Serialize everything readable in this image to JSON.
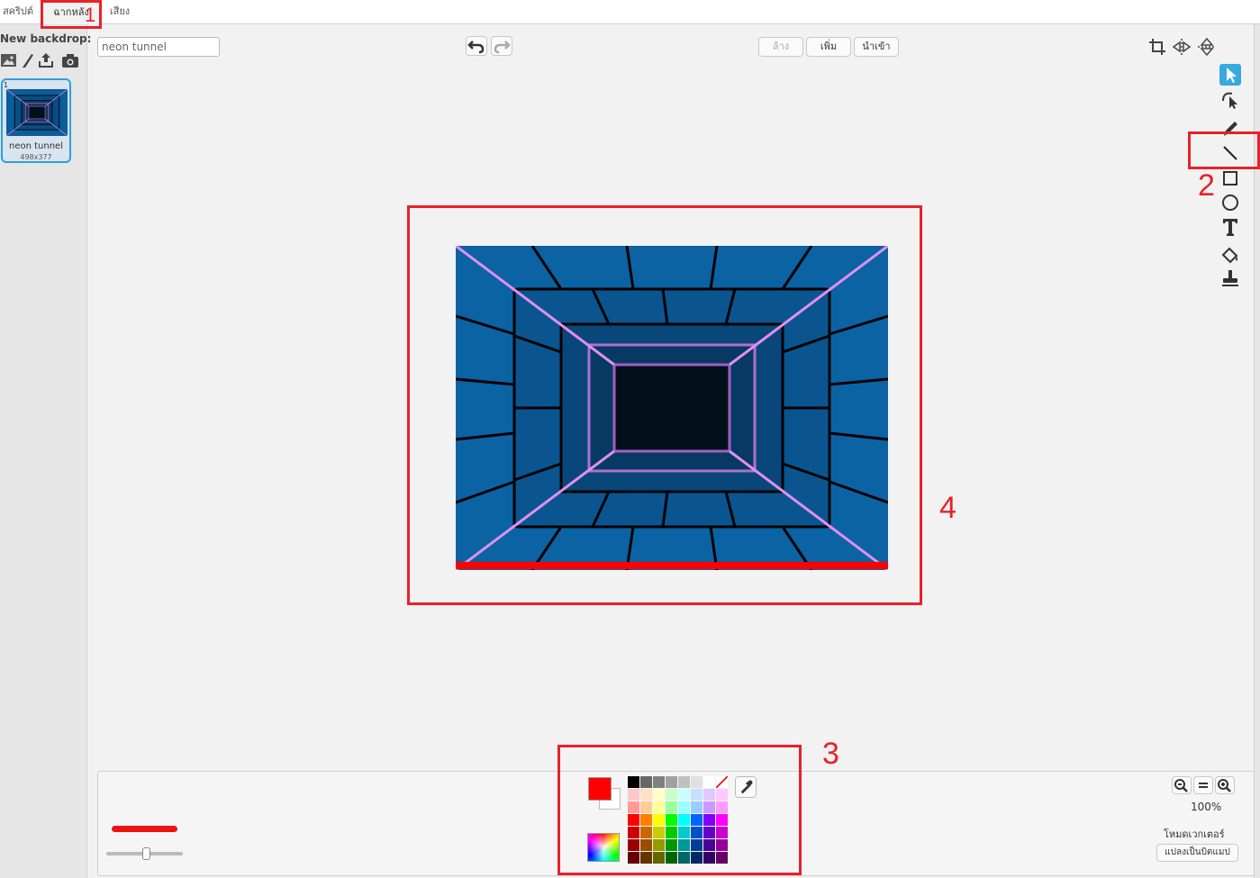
{
  "tabs": [
    {
      "label": "สคริปต์"
    },
    {
      "label": "ฉากหลัง"
    },
    {
      "label": "เสียง"
    }
  ],
  "sidebar": {
    "title": "New backdrop:",
    "icons": [
      "image-library-icon",
      "paint-brush-icon",
      "upload-icon",
      "camera-icon"
    ],
    "backdrops": [
      {
        "number": "1",
        "name": "neon tunnel",
        "size": "498x377"
      }
    ]
  },
  "editor": {
    "name_value": "neon tunnel",
    "top_buttons": {
      "clear": "ล้าง",
      "add": "เพิ่ม",
      "import": "นำเข้า"
    }
  },
  "tools": [
    "select",
    "reshape",
    "pencil",
    "line",
    "rectangle",
    "ellipse",
    "text",
    "fill",
    "stamp"
  ],
  "bottom": {
    "primary_color": "#ff0000",
    "secondary_color": "#ffffff",
    "stroke_color": "#ee1111",
    "zoom_level": "100%",
    "mode_label": "โหมดเวกเตอร์",
    "convert_label": "แปลงเป็นบิตแมป"
  },
  "palette": [
    "#000000",
    "#666666",
    "#808080",
    "#a0a0a0",
    "#c0c0c0",
    "#e0e0e0",
    "#ffffff",
    "transparent",
    "#ffc8c8",
    "#ffe0c8",
    "#ffffc8",
    "#c8ffc8",
    "#c8ffff",
    "#c8e0ff",
    "#e0c8ff",
    "#ffc8ff",
    "#ff9999",
    "#ffcc99",
    "#ffff99",
    "#99ff99",
    "#99ffff",
    "#99ccff",
    "#cc99ff",
    "#ff99ff",
    "#ff0000",
    "#ff8000",
    "#ffff00",
    "#00ff00",
    "#00ffff",
    "#0066ff",
    "#8000ff",
    "#ff00ff",
    "#cc0000",
    "#cc6600",
    "#cccc00",
    "#00cc00",
    "#00cccc",
    "#0050cc",
    "#6600cc",
    "#cc00cc",
    "#990000",
    "#994d00",
    "#999900",
    "#009900",
    "#009999",
    "#003d99",
    "#4d0099",
    "#990099",
    "#660000",
    "#663300",
    "#666600",
    "#006600",
    "#006666",
    "#002966",
    "#330066",
    "#660066"
  ],
  "annotations": [
    {
      "label": "1"
    },
    {
      "label": "2"
    },
    {
      "label": "3"
    },
    {
      "label": "4"
    }
  ]
}
